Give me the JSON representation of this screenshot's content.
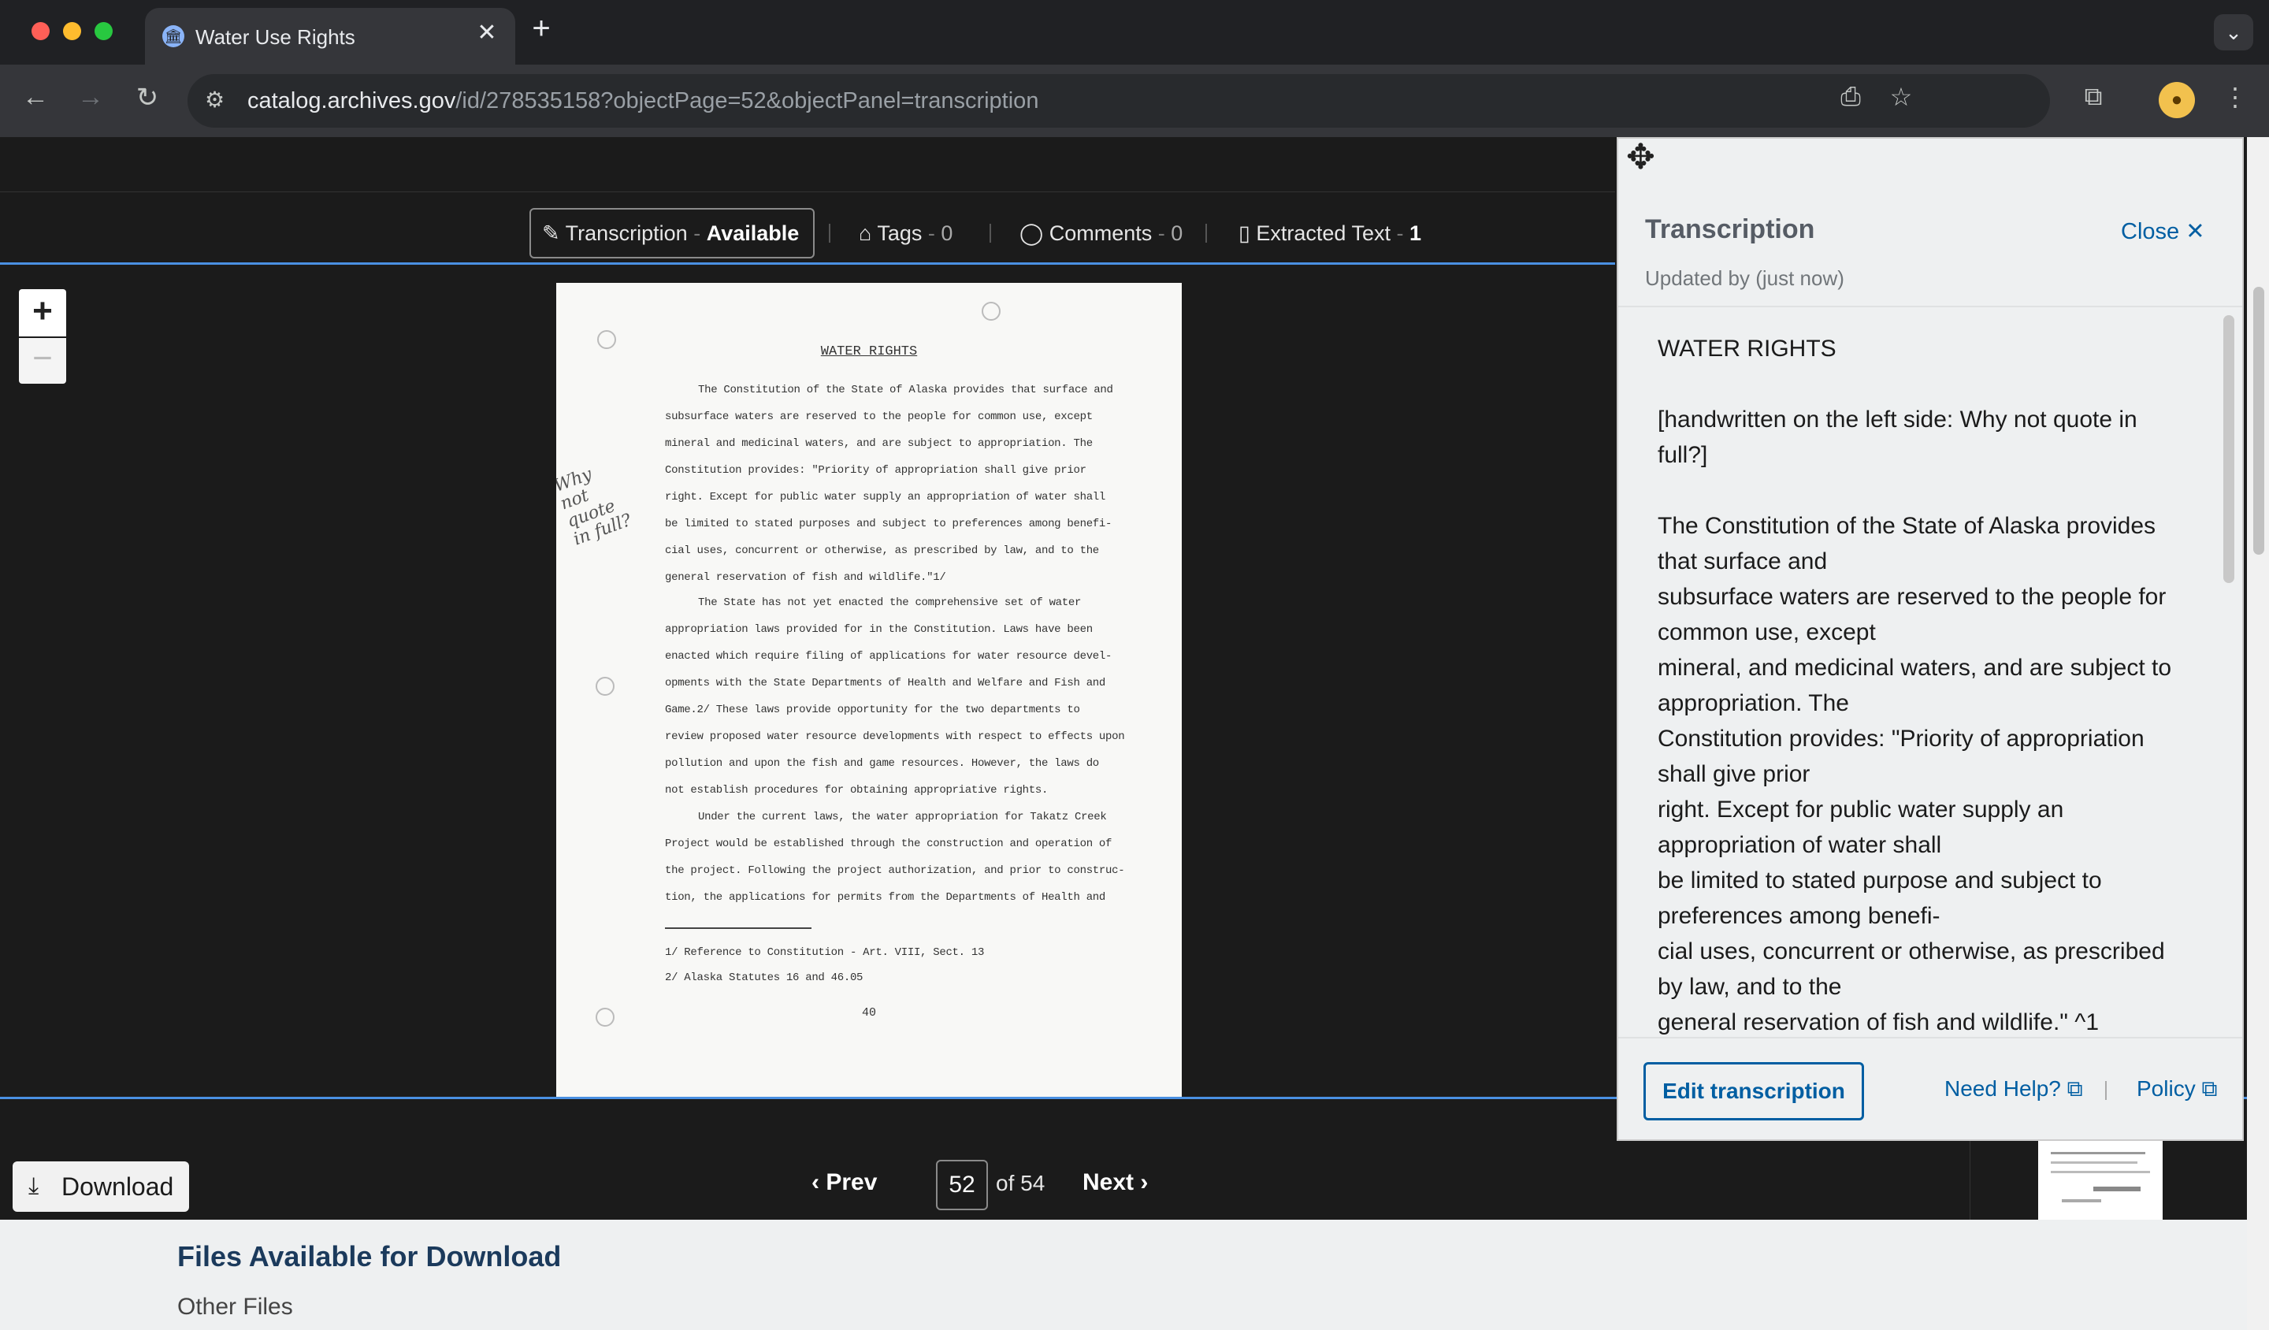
{
  "browser": {
    "tab_title": "Water Use Rights",
    "tab_close": "✕",
    "new_tab": "+",
    "url_host": "catalog.archives.gov",
    "url_path": "/id/278535158?objectPage=52&objectPanel=transcription"
  },
  "tabs": {
    "transcription_label": "Transcription",
    "transcription_status": "Available",
    "tags_label": "Tags",
    "tags_count": "0",
    "comments_label": "Comments",
    "comments_count": "0",
    "extracted_label": "Extracted Text",
    "extracted_count": "1",
    "separator": "-"
  },
  "viewer": {
    "zoom_in": "+",
    "zoom_out": "−"
  },
  "document": {
    "title": "WATER RIGHTS",
    "lines": [
      "The Constitution of the State of Alaska provides that surface and",
      "subsurface waters are reserved to the people for common use, except",
      "mineral and medicinal waters, and are subject to appropriation.  The",
      "Constitution provides:  \"Priority of appropriation shall give prior",
      "right.  Except for public water supply an appropriation of water shall",
      "be limited to stated purposes and subject to preferences among benefi-",
      "cial uses, concurrent or otherwise, as prescribed by law, and to the",
      "general reservation of fish and wildlife.\"1/",
      "The State has not yet enacted the comprehensive set of water",
      "appropriation laws provided for in the Constitution.  Laws have been",
      "enacted which require filing of applications for water resource devel-",
      "opments with the State Departments of Health and Welfare and Fish and",
      "Game.2/  These laws provide opportunity for the two departments to",
      "review proposed water resource developments with respect to effects upon",
      "pollution and upon the fish and game resources.  However, the laws do",
      "not establish procedures for obtaining appropriative rights.",
      "Under the current laws, the water appropriation for Takatz Creek",
      "Project would be established through the construction and operation of",
      "the project.  Following the project authorization, and prior to construc-",
      "tion, the applications for permits from the Departments of Health and"
    ],
    "footnote1": "1/  Reference to Constitution - Art. VIII, Sect. 13",
    "footnote2": "2/  Alaska Statutes 16 and 46.05",
    "handwritten": "Why not quote in full?",
    "page_number": "40"
  },
  "pager": {
    "download": "Download",
    "prev": "Prev",
    "current_page": "52",
    "of_pages": "of 54",
    "next": "Next"
  },
  "files": {
    "title": "Files Available for Download",
    "subtitle": "Other Files"
  },
  "panel": {
    "title": "Transcription",
    "close": "Close",
    "updated": "Updated by (just now)",
    "text": "WATER RIGHTS\n\n[handwritten on the left side: Why not quote in full?]\n\nThe Constitution of the State of Alaska provides that surface and\nsubsurface waters are reserved to the people for common use, except\nmineral, and medicinal waters, and are subject to appropriation. The\nConstitution provides: \"Priority of appropriation shall give prior\nright. Except for public water supply an appropriation of water shall\nbe limited to stated purpose and subject to preferences among benefi-\ncial uses, concurrent or otherwise, as prescribed by law, and to the\ngeneral reservation of fish and wildlife.\" ^1",
    "edit": "Edit transcription",
    "help": "Need Help?",
    "policy": "Policy"
  }
}
